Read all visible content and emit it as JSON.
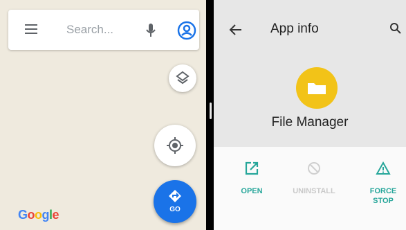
{
  "maps": {
    "search_placeholder": "Search...",
    "go_label": "GO",
    "logo_text": "Google",
    "icons": [
      "menu-icon",
      "mic-icon",
      "account-icon",
      "layers-icon",
      "my-location-icon",
      "directions-icon"
    ],
    "colors": {
      "primary": "#1a73e8",
      "background": "#efeade"
    }
  },
  "app_info": {
    "title": "App info",
    "app_name": "File Manager",
    "actions": [
      {
        "label": "OPEN",
        "enabled": true
      },
      {
        "label": "UNINSTALL",
        "enabled": false
      },
      {
        "label": "FORCE STOP",
        "enabled": true
      }
    ],
    "colors": {
      "accent": "#26a69a",
      "app_icon": "#f2c318"
    }
  }
}
